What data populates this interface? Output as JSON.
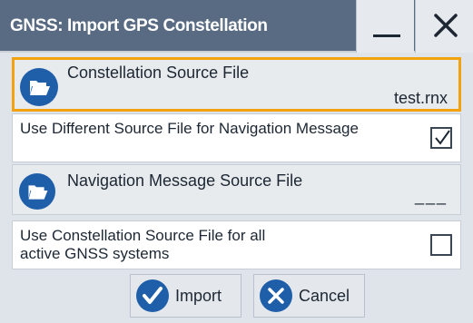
{
  "window": {
    "title": "GNSS: Import GPS Constellation",
    "minimize_icon": "minimize-icon",
    "close_icon": "close-icon"
  },
  "constellation_source": {
    "label": "Constellation Source File",
    "value": "test.rnx",
    "icon": "folder-open-icon"
  },
  "different_nav_file": {
    "label": "Use Different Source File for Navigation Message",
    "checked": true
  },
  "nav_message_source": {
    "label": "Navigation Message Source File",
    "value": "___",
    "icon": "folder-open-icon"
  },
  "use_for_all_systems": {
    "label": "Use Constellation Source File for all active GNSS systems",
    "checked": false
  },
  "buttons": {
    "import": "Import",
    "cancel": "Cancel"
  },
  "colors": {
    "title_bar": "#586b82",
    "accent_blue": "#1f5fa9",
    "focus_border": "#f2a10f",
    "panel": "#dfe4ea"
  }
}
